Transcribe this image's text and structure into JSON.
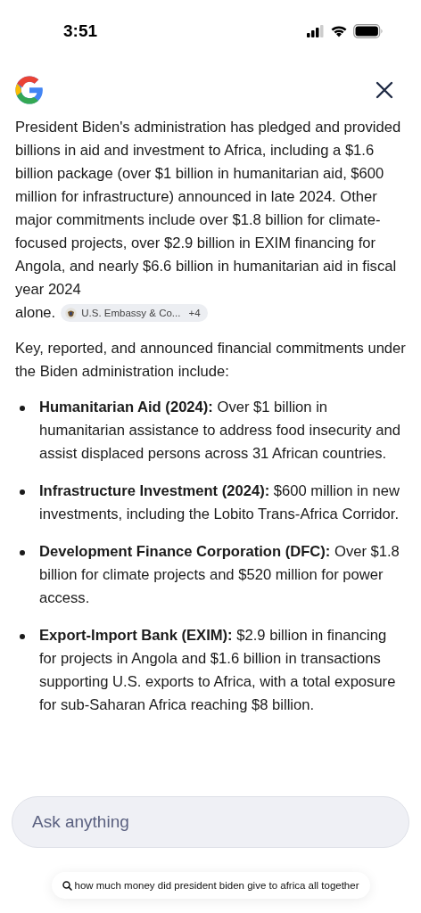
{
  "status_bar": {
    "time": "3:51"
  },
  "answer": {
    "paragraph": "President Biden's administration has pledged and provided billions in aid and investment to Africa, including a $1.6 billion package (over $1 billion in humanitarian aid, $600 million for infrastructure) announced in late 2024. Other major commitments include over $1.8 billion for climate-focused projects, over $2.9 billion in EXIM financing for Angola, and nearly $6.6 billion in humanitarian aid in fiscal year 2024",
    "paragraph_end": "alone.",
    "source_chip": {
      "label": "U.S. Embassy & Co...",
      "count": "+4"
    },
    "intro": "Key, reported, and announced financial commitments under the Biden administration include:",
    "bullets": [
      {
        "text": "**Humanitarian Aid (2024):** Over $1 billion in humanitarian assistance to address food insecurity and assist displaced persons across 31 African countries."
      },
      {
        "text": "**Infrastructure Investment (2024):** $600 million in new investments, including the Lobito Trans-Africa Corridor."
      },
      {
        "text": "**Development Finance Corporation (DFC):** Over $1.8 billion for climate projects and $520 million for power access."
      },
      {
        "text": "**Export-Import Bank (EXIM):** $2.9 billion in financing for projects in Angola and $1.6 billion in transactions supporting U.S. exports to Africa, with a total exposure for sub-Saharan Africa reaching $8 billion."
      }
    ]
  },
  "ask_field": {
    "placeholder": "Ask anything"
  },
  "query_chip": {
    "text": "how much money did president biden give to africa all together"
  }
}
